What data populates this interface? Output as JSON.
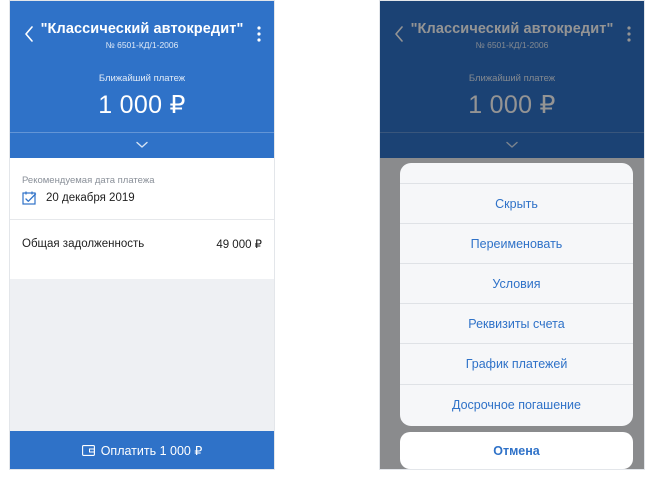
{
  "colors": {
    "primary": "#2f72c8",
    "overlay": "rgba(0,0,0,0.42)",
    "text": "#1e1e1e",
    "muted": "#8a9099"
  },
  "icons": {
    "back": "chevron-left-icon",
    "more": "more-vertical-icon",
    "expand": "chevron-down-icon",
    "calendar": "calendar-check-icon",
    "wallet": "wallet-icon"
  },
  "left": {
    "header": {
      "title": "\"Классический автокредит\"",
      "subtitle": "№ 6501-КД/1-2006",
      "payment_label": "Ближайший платеж",
      "payment_amount": "1 000 ₽"
    },
    "card": {
      "date_label": "Рекомендуемая дата платежа",
      "date_value": "20 декабря 2019",
      "debt_label": "Общая задолженность",
      "debt_value": "49 000 ₽"
    },
    "pay_button_label": "Оплатить 1 000 ₽"
  },
  "right": {
    "header": {
      "title": "\"Классический автокредит\"",
      "subtitle": "№ 6501-КД/1-2006",
      "payment_label": "Ближайший платеж",
      "payment_amount": "1 000 ₽"
    },
    "menu": {
      "items": [
        {
          "label": "Скрыть"
        },
        {
          "label": "Переименовать"
        },
        {
          "label": "Условия"
        },
        {
          "label": "Реквизиты счета"
        },
        {
          "label": "График платежей"
        },
        {
          "label": "Досрочное погашение"
        }
      ],
      "cancel_label": "Отмена"
    }
  }
}
